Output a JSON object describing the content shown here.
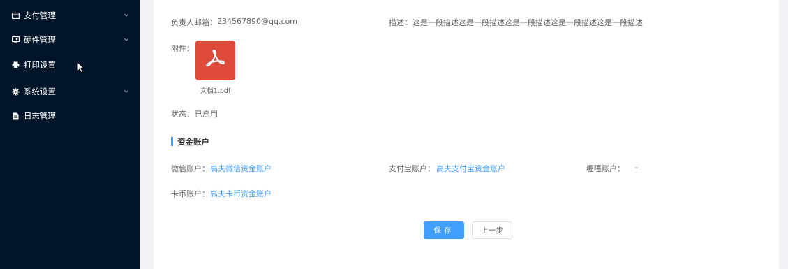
{
  "sidebar": {
    "items": [
      {
        "label": "支付管理",
        "icon": "credit-card-icon",
        "has_submenu": true
      },
      {
        "label": "硬件管理",
        "icon": "hardware-icon",
        "has_submenu": true
      },
      {
        "label": "打印设置",
        "icon": "printer-icon",
        "has_submenu": false
      },
      {
        "label": "系统设置",
        "icon": "gear-icon",
        "has_submenu": true
      },
      {
        "label": "日志管理",
        "icon": "document-icon",
        "has_submenu": false
      }
    ]
  },
  "detail": {
    "email_label": "负责人邮箱：",
    "email_value": "234567890@qq.com",
    "desc_label": "描述：",
    "desc_value": "这是一段描述这是一段描述这是一段描述这是一段描述这是一段描述",
    "attachment_label": "附件：",
    "attachment_file": "文档1.pdf",
    "attachment_icon": "pdf-file-icon",
    "status_label": "状态：",
    "status_value": "已启用"
  },
  "fund_section": {
    "title": "资金账户",
    "wechat_label": "微信账户：",
    "wechat_value": "高夫微信资金账户",
    "alipay_label": "支付宝账户：",
    "alipay_value": "高夫支付宝资金账户",
    "other_label": "喔噻账户：",
    "other_value": "–",
    "card_label": "卡币账户：",
    "card_value": "高夫卡币资金账户"
  },
  "actions": {
    "save_label": "保存",
    "back_label": "上一步"
  },
  "colors": {
    "sidebar_bg": "#001529",
    "accent": "#409eff",
    "pdf_red": "#de4b3a"
  }
}
